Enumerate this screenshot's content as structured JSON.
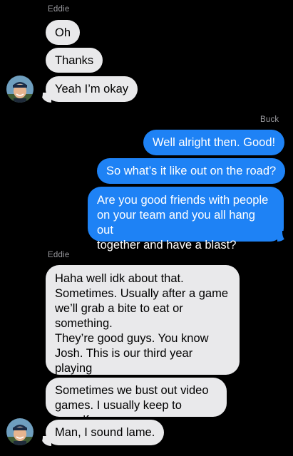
{
  "conversation": {
    "group1": {
      "sender": "Eddie",
      "messages": [
        "Oh",
        "Thanks",
        "Yeah I’m okay"
      ]
    },
    "group2": {
      "sender": "Buck",
      "messages": [
        "Well alright then. Good!",
        "So what’s it like out on the road?",
        "Are you good friends with people\non your team and you all hang out\ntogether and have a blast?"
      ]
    },
    "group3": {
      "sender": "Eddie",
      "messages": [
        "Haha well idk about that.\nSometimes. Usually after a game\nwe’ll grab a bite to eat or\nsomething.\nThey’re good guys. You know\nJosh. This is our third year playing\ntogether.",
        "Sometimes we bust out video\ngames. I usually keep to myself.",
        "Man, I sound lame."
      ]
    }
  },
  "colors": {
    "background": "#000000",
    "incoming_bubble": "#e9e9eb",
    "outgoing_bubble": "#1e82f5",
    "sender_label": "#9a9a9f"
  },
  "icons": {
    "avatar": "contact-photo-eddie"
  }
}
